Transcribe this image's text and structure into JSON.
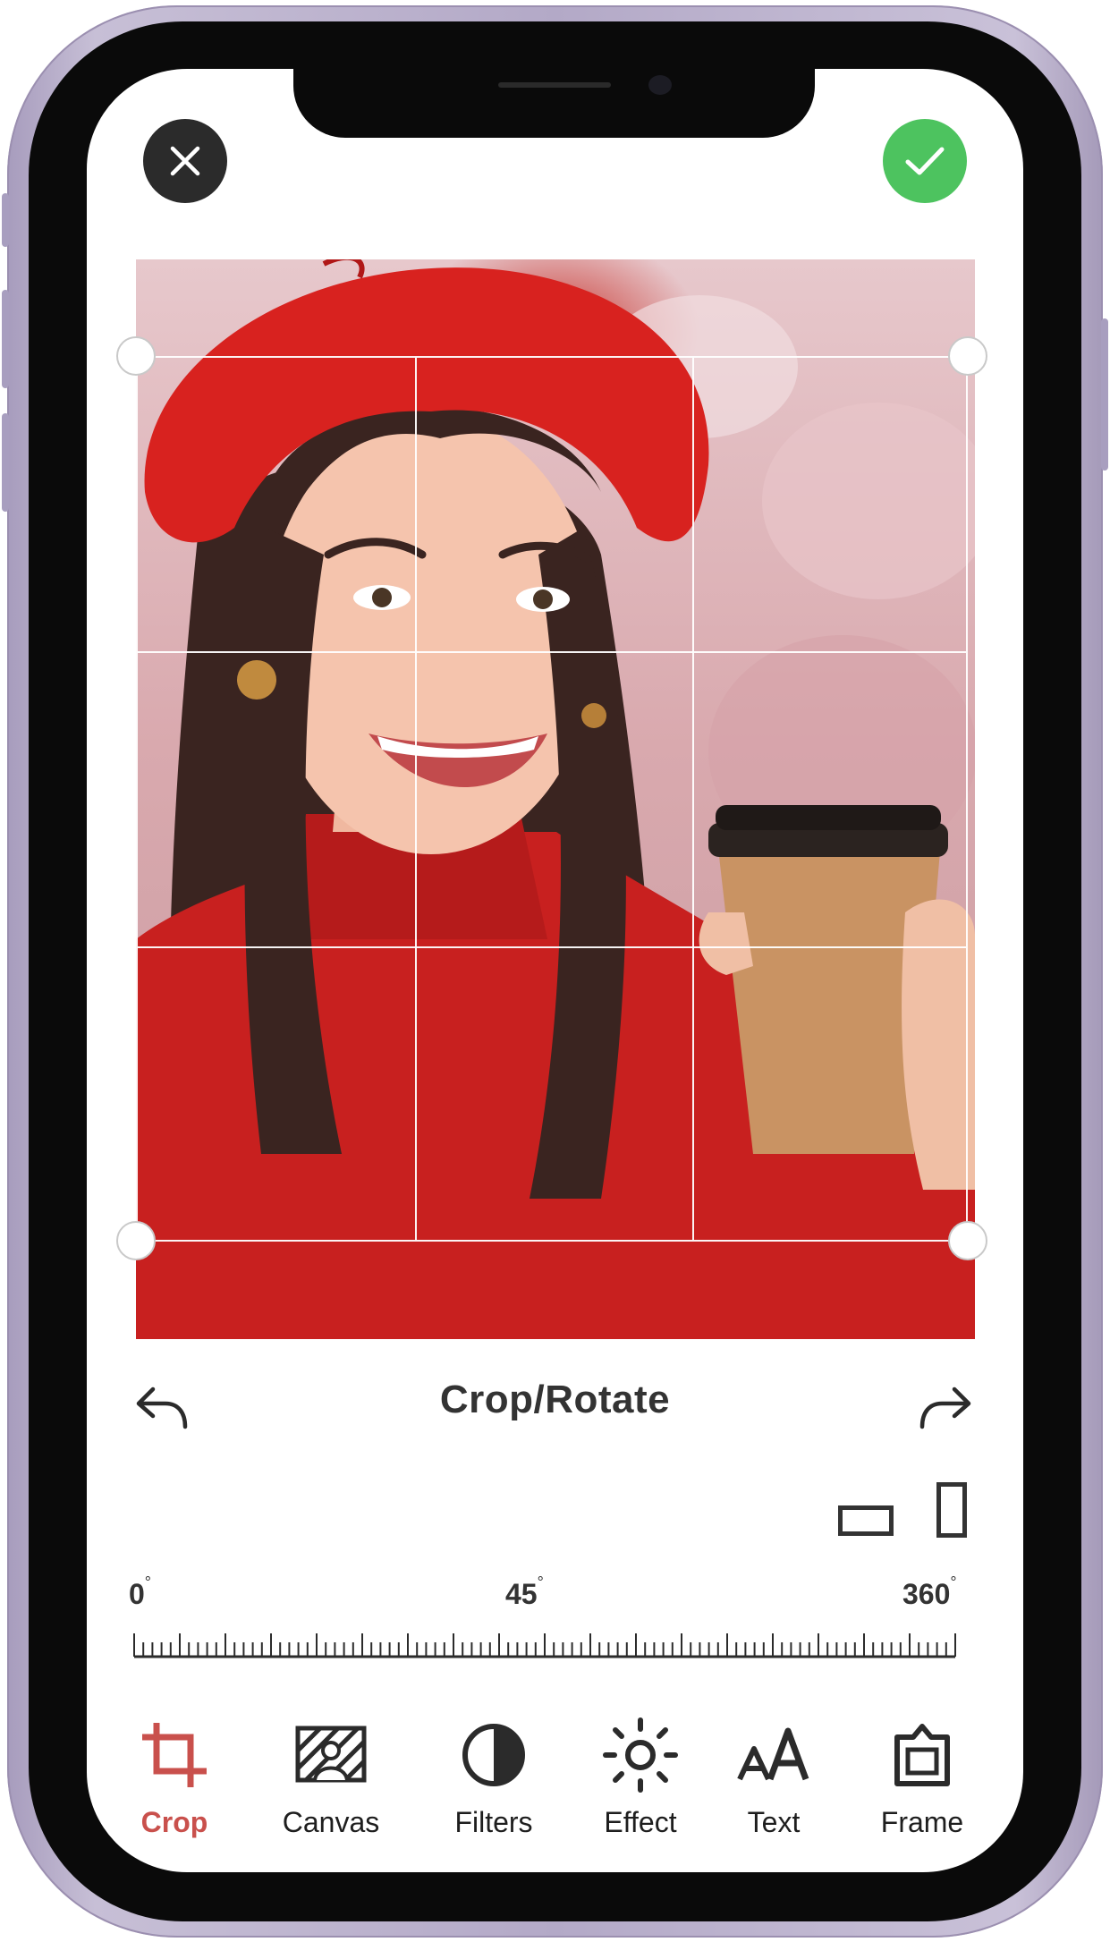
{
  "header": {
    "close_icon": "close-icon",
    "confirm_icon": "check-icon"
  },
  "editor": {
    "title": "Crop/Rotate",
    "undo_icon": "undo-arrow-icon",
    "redo_icon": "redo-arrow-icon"
  },
  "rotation": {
    "labels": [
      {
        "value": "0",
        "unit": "°"
      },
      {
        "value": "45",
        "unit": "°"
      },
      {
        "value": "360",
        "unit": "°"
      }
    ]
  },
  "toolbar": {
    "items": [
      {
        "label": "Crop",
        "icon": "crop-icon",
        "active": true
      },
      {
        "label": "Canvas",
        "icon": "canvas-icon",
        "active": false
      },
      {
        "label": "Filters",
        "icon": "filters-icon",
        "active": false
      },
      {
        "label": "Effect",
        "icon": "sun-icon",
        "active": false
      },
      {
        "label": "Text",
        "icon": "text-size-icon",
        "active": false
      },
      {
        "label": "Frame",
        "icon": "frame-icon",
        "active": false
      }
    ]
  },
  "colors": {
    "accent": "#c9504c",
    "confirm": "#4dc35f",
    "close": "#2b2b2b",
    "text": "#333333"
  }
}
